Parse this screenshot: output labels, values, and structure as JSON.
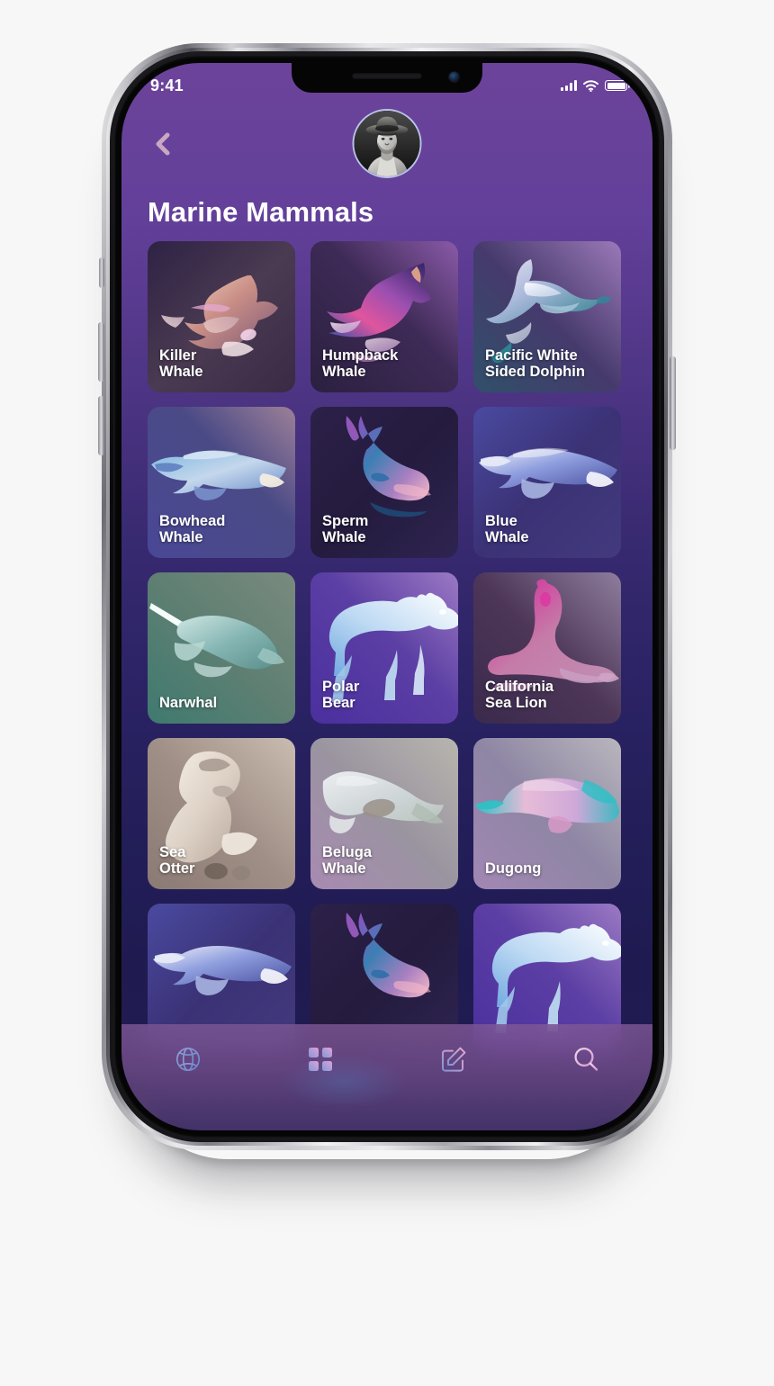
{
  "device": {
    "frame": "iphone-x",
    "buttons": [
      "silence-switch",
      "volume-up",
      "volume-down",
      "power-button"
    ]
  },
  "status_bar": {
    "time": "9:41",
    "signal_icon": "cellular-signal-icon",
    "signal_bars": 4,
    "wifi_icon": "wifi-icon",
    "battery_icon": "battery-icon",
    "battery_level": 100
  },
  "header": {
    "back_icon": "chevron-left-icon",
    "avatar_name": "user-avatar",
    "avatar_alt": "Portrait of a person wearing a wide brimmed hat, black and white"
  },
  "page": {
    "title": "Marine Mammals"
  },
  "colors": {
    "bg_top": "#6C439A",
    "bg_bottom": "#1F1B51",
    "accent": "#C9A6DA",
    "text": "#FFFFFF",
    "tabbar": "#7A5494"
  },
  "grid": {
    "columns": 3,
    "cards": [
      {
        "label": "Killer\nWhale",
        "name": "killer-whale",
        "art": "orca"
      },
      {
        "label": "Humpback\nWhale",
        "name": "humpback-whale",
        "art": "humpback"
      },
      {
        "label": "Pacific White\nSided Dolphin",
        "name": "pacific-white-sided-dolphin",
        "art": "dolphin"
      },
      {
        "label": "Bowhead\nWhale",
        "name": "bowhead-whale",
        "art": "bowhead"
      },
      {
        "label": "Sperm\nWhale",
        "name": "sperm-whale",
        "art": "sperm"
      },
      {
        "label": "Blue\nWhale",
        "name": "blue-whale",
        "art": "blue"
      },
      {
        "label": "Narwhal",
        "name": "narwhal",
        "art": "narwhal"
      },
      {
        "label": "Polar\nBear",
        "name": "polar-bear",
        "art": "polarbear"
      },
      {
        "label": "California\nSea Lion",
        "name": "california-sea-lion",
        "art": "sealion"
      },
      {
        "label": "Sea\nOtter",
        "name": "sea-otter",
        "art": "otter"
      },
      {
        "label": "Beluga\nWhale",
        "name": "beluga-whale",
        "art": "beluga"
      },
      {
        "label": "Dugong",
        "name": "dugong",
        "art": "dugong"
      },
      {
        "label": "",
        "name": "bowhead-whale-2",
        "art": "bowhead"
      },
      {
        "label": "",
        "name": "sperm-whale-2",
        "art": "sperm"
      },
      {
        "label": "",
        "name": "polar-bear-2",
        "art": "polarbear"
      }
    ]
  },
  "tabbar": {
    "items": [
      {
        "label": "Explore",
        "icon": "globe-icon"
      },
      {
        "label": "Browse",
        "icon": "grid-icon"
      },
      {
        "label": "Compose",
        "icon": "edit-square-icon"
      },
      {
        "label": "Search",
        "icon": "search-icon"
      }
    ]
  }
}
